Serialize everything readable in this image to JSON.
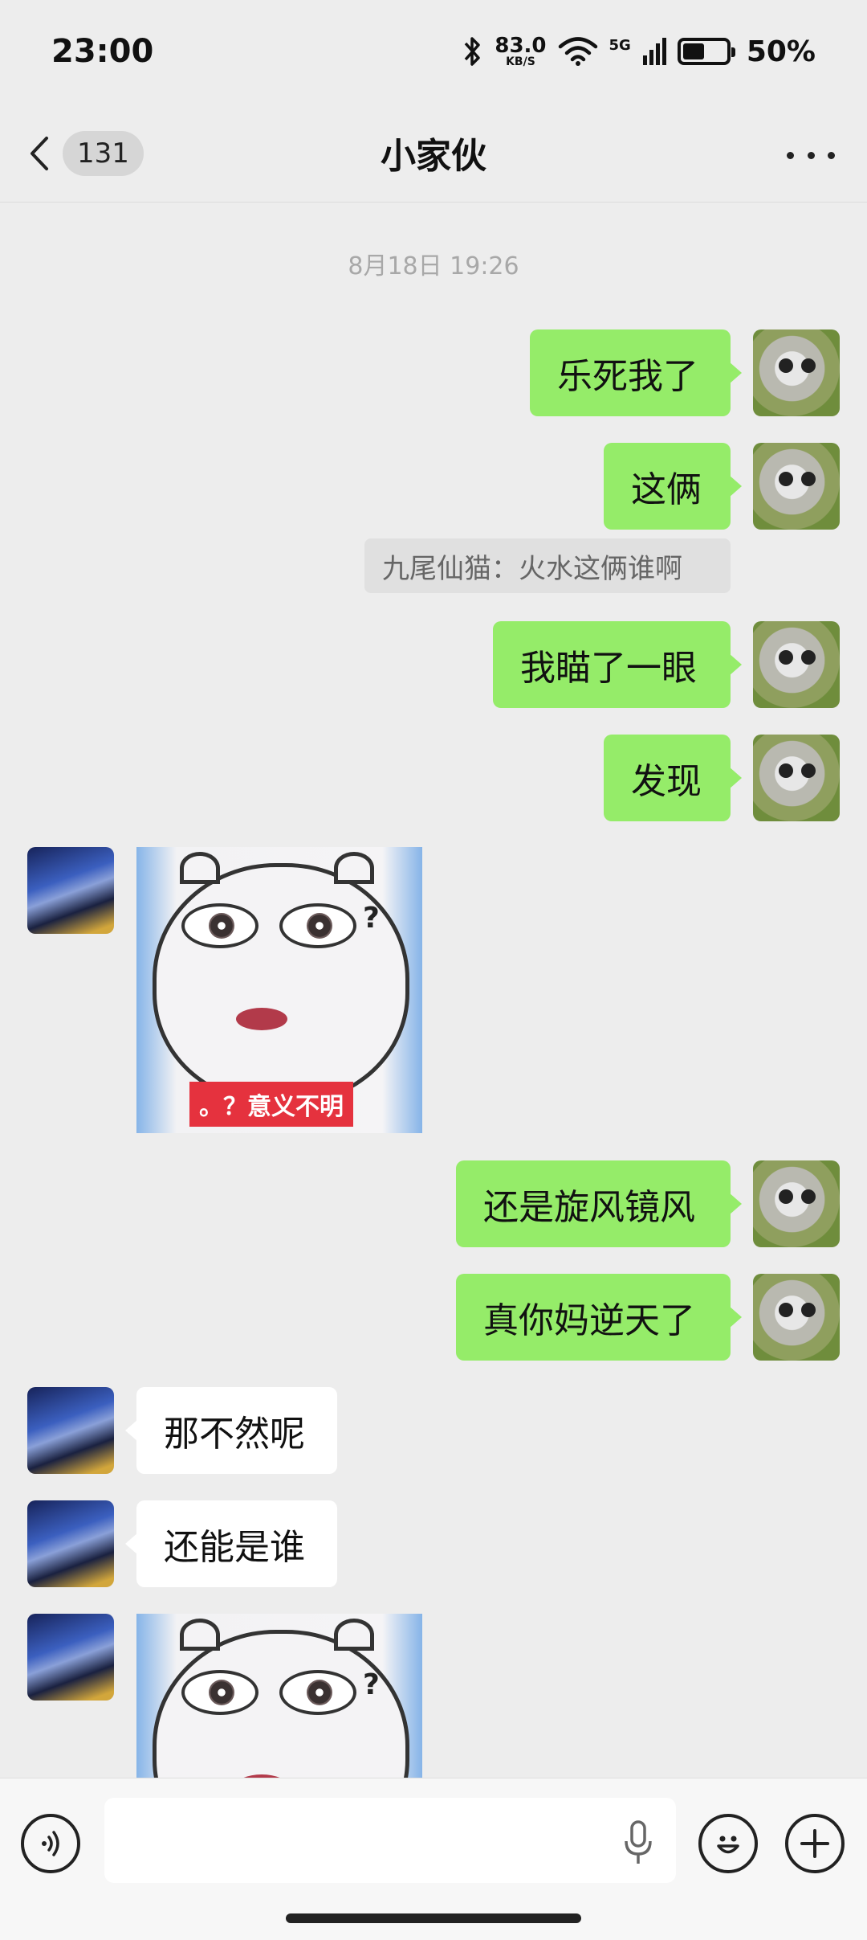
{
  "status_bar": {
    "time": "23:00",
    "net_speed_value": "83.0",
    "net_speed_unit": "KB/S",
    "network": "5G",
    "battery_percent": "50%",
    "battery_level": 0.5,
    "icons": [
      "bluetooth-icon",
      "wifi-icon",
      "signal-icon",
      "battery-icon"
    ]
  },
  "header": {
    "unread_count": "131",
    "title": "小家伙",
    "more_icon": "more-dots-icon"
  },
  "chat": {
    "timestamp": "8月18日 19:26",
    "messages": [
      {
        "side": "right",
        "type": "text",
        "text": "乐死我了"
      },
      {
        "side": "right",
        "type": "text",
        "text": "这俩"
      },
      {
        "side": "right",
        "type": "quote",
        "text": "九尾仙猫：火水这俩谁啊"
      },
      {
        "side": "right",
        "type": "text",
        "text": "我瞄了一眼"
      },
      {
        "side": "right",
        "type": "text",
        "text": "发现"
      },
      {
        "side": "left",
        "type": "sticker",
        "caption": "。？意义不明",
        "mark": "?"
      },
      {
        "side": "right",
        "type": "text",
        "text": "还是旋风镜风"
      },
      {
        "side": "right",
        "type": "text",
        "text": "真你妈逆天了"
      },
      {
        "side": "left",
        "type": "text",
        "text": "那不然呢"
      },
      {
        "side": "left",
        "type": "text",
        "text": "还能是谁"
      },
      {
        "side": "left",
        "type": "sticker",
        "mark": "?"
      }
    ]
  },
  "input_bar": {
    "voice_icon": "voice-icon",
    "mic_icon": "mic-icon",
    "emoji_icon": "emoji-icon",
    "plus_icon": "plus-icon",
    "input_value": ""
  },
  "colors": {
    "background": "#ededed",
    "my_bubble": "#95ec69",
    "their_bubble": "#ffffff"
  }
}
